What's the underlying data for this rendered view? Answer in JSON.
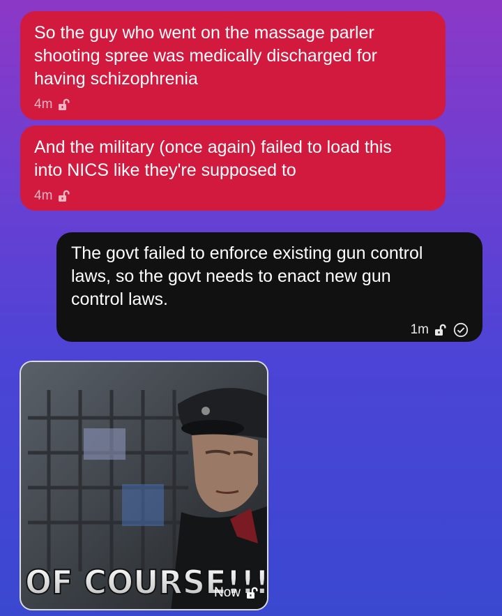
{
  "messages": [
    {
      "direction": "incoming",
      "lines": [
        "So the guy who went on the massage parler",
        "shooting spree was medically discharged for",
        "having schizophrenia"
      ],
      "time": "4m"
    },
    {
      "direction": "incoming",
      "lines": [
        "And the military (once again) failed to load this",
        "into NICS like they're supposed to"
      ],
      "time": "4m"
    },
    {
      "direction": "outgoing",
      "lines": [
        "The govt failed to enforce existing gun control",
        "laws, so the govt needs to enact new gun",
        "control laws."
      ],
      "time": "1m"
    }
  ],
  "image_message": {
    "caption_in_image": "OF COURSE!!!",
    "time": "Now"
  },
  "colors": {
    "incoming_bubble": "#d2193e",
    "outgoing_bubble": "#111111",
    "background_top": "#8c38c6",
    "background_bottom": "#3a48d0"
  },
  "icons": [
    "lock-icon",
    "read-check-icon"
  ]
}
